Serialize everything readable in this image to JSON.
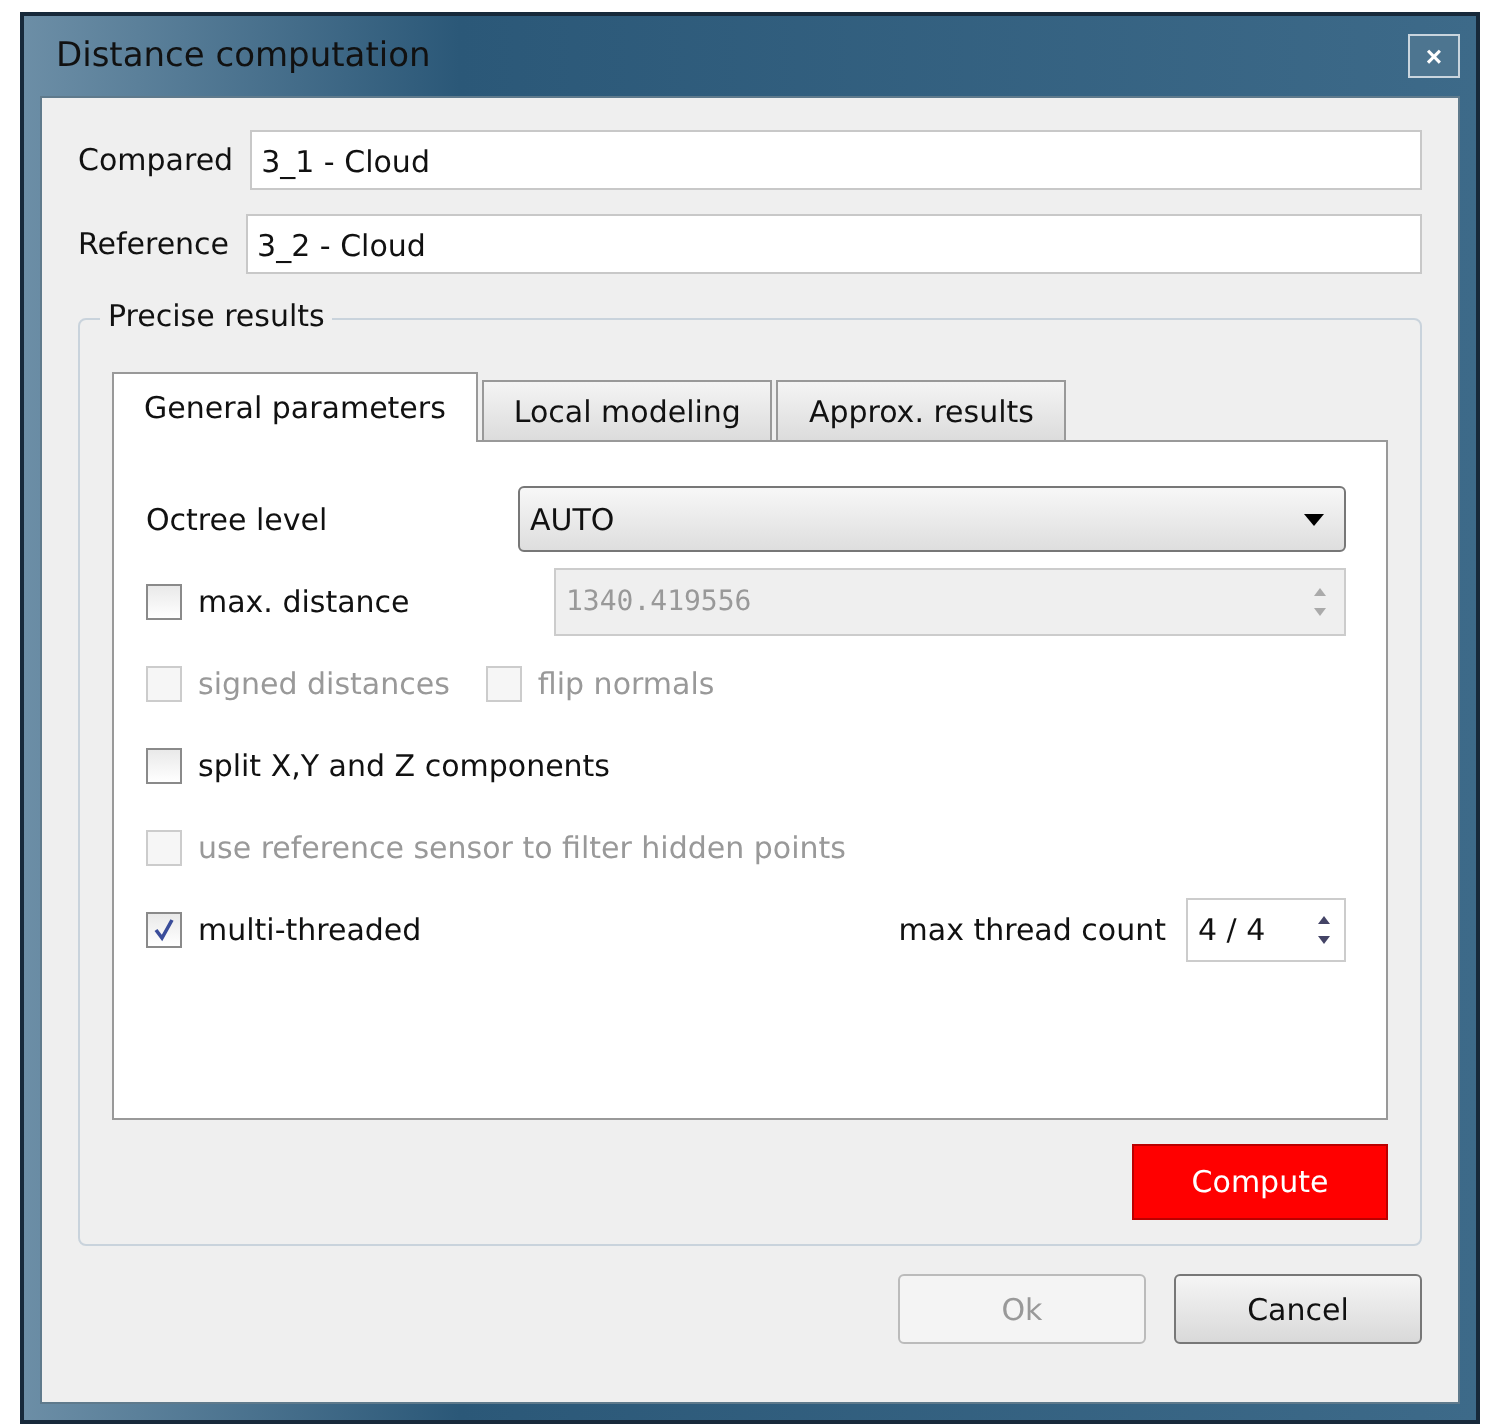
{
  "window": {
    "title": "Distance computation",
    "close": "×"
  },
  "fields": [
    {
      "label": "Compared",
      "value": "3_1 - Cloud"
    },
    {
      "label": "Reference",
      "value": "3_2 - Cloud"
    }
  ],
  "group": {
    "title": "Precise results",
    "tabs": [
      {
        "label": "General parameters",
        "selected": true
      },
      {
        "label": "Local modeling",
        "selected": false
      },
      {
        "label": "Approx. results",
        "selected": false
      }
    ],
    "rows": [
      {
        "kind": "select",
        "label": "Octree level",
        "value": "AUTO"
      },
      {
        "kind": "check_field",
        "checks": [
          {
            "label": "max. distance",
            "checked": false,
            "disabled": false
          }
        ],
        "field": {
          "value": "1340.419556",
          "disabled": true
        }
      },
      {
        "kind": "checks",
        "checks": [
          {
            "label": "signed distances",
            "checked": false,
            "disabled": true
          },
          {
            "label": "flip normals",
            "checked": false,
            "disabled": true
          }
        ]
      },
      {
        "kind": "checks",
        "checks": [
          {
            "label": "split X,Y and Z components",
            "checked": false,
            "disabled": false
          }
        ]
      },
      {
        "kind": "checks",
        "checks": [
          {
            "label": "use reference sensor to filter hidden points",
            "checked": false,
            "disabled": true
          }
        ]
      },
      {
        "kind": "check_spin",
        "checks": [
          {
            "label": "multi-threaded",
            "checked": true,
            "disabled": false
          }
        ],
        "spin": {
          "label": "max thread count",
          "value": "4 / 4"
        }
      }
    ],
    "action": {
      "label": "Compute"
    }
  },
  "buttons": [
    {
      "label": "Ok",
      "disabled": true
    },
    {
      "label": "Cancel",
      "disabled": false
    }
  ]
}
